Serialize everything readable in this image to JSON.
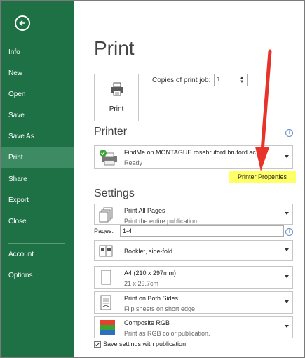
{
  "sidebar": {
    "items": [
      {
        "label": "Info"
      },
      {
        "label": "New"
      },
      {
        "label": "Open"
      },
      {
        "label": "Save"
      },
      {
        "label": "Save As"
      },
      {
        "label": "Print",
        "active": true
      },
      {
        "label": "Share"
      },
      {
        "label": "Export"
      },
      {
        "label": "Close"
      },
      {
        "label": "Account"
      },
      {
        "label": "Options"
      }
    ],
    "back_icon": "back-arrow-icon",
    "colors": {
      "background": "#1e7145",
      "active": "#3d8b63"
    }
  },
  "main": {
    "title": "Print",
    "print_button_label": "Print",
    "copies_label": "Copies of print job:",
    "copies_value": "1",
    "printer_heading": "Printer",
    "printer_name": "FindMe on MONTAGUE.rosebruford.bruford.ac.uk",
    "printer_status": "Ready",
    "printer_properties": "Printer Properties",
    "settings_heading": "Settings",
    "pages_label": "Pages:",
    "pages_value": "1-4",
    "settings": [
      {
        "title": "Print All Pages",
        "subtitle": "Print the entire publication"
      },
      {
        "title": "Booklet, side-fold",
        "subtitle": ""
      },
      {
        "title": "A4 (210 x 297mm)",
        "subtitle": "21 x 29.7cm"
      },
      {
        "title": "Print on Both Sides",
        "subtitle": "Flip sheets on short edge"
      },
      {
        "title": "Composite RGB",
        "subtitle": "Print as RGB color publication."
      }
    ],
    "save_settings_label": "Save settings with publication",
    "save_settings_checked": true,
    "highlight_color": "#ffff66",
    "annotation_arrow_color": "#e8332a"
  }
}
